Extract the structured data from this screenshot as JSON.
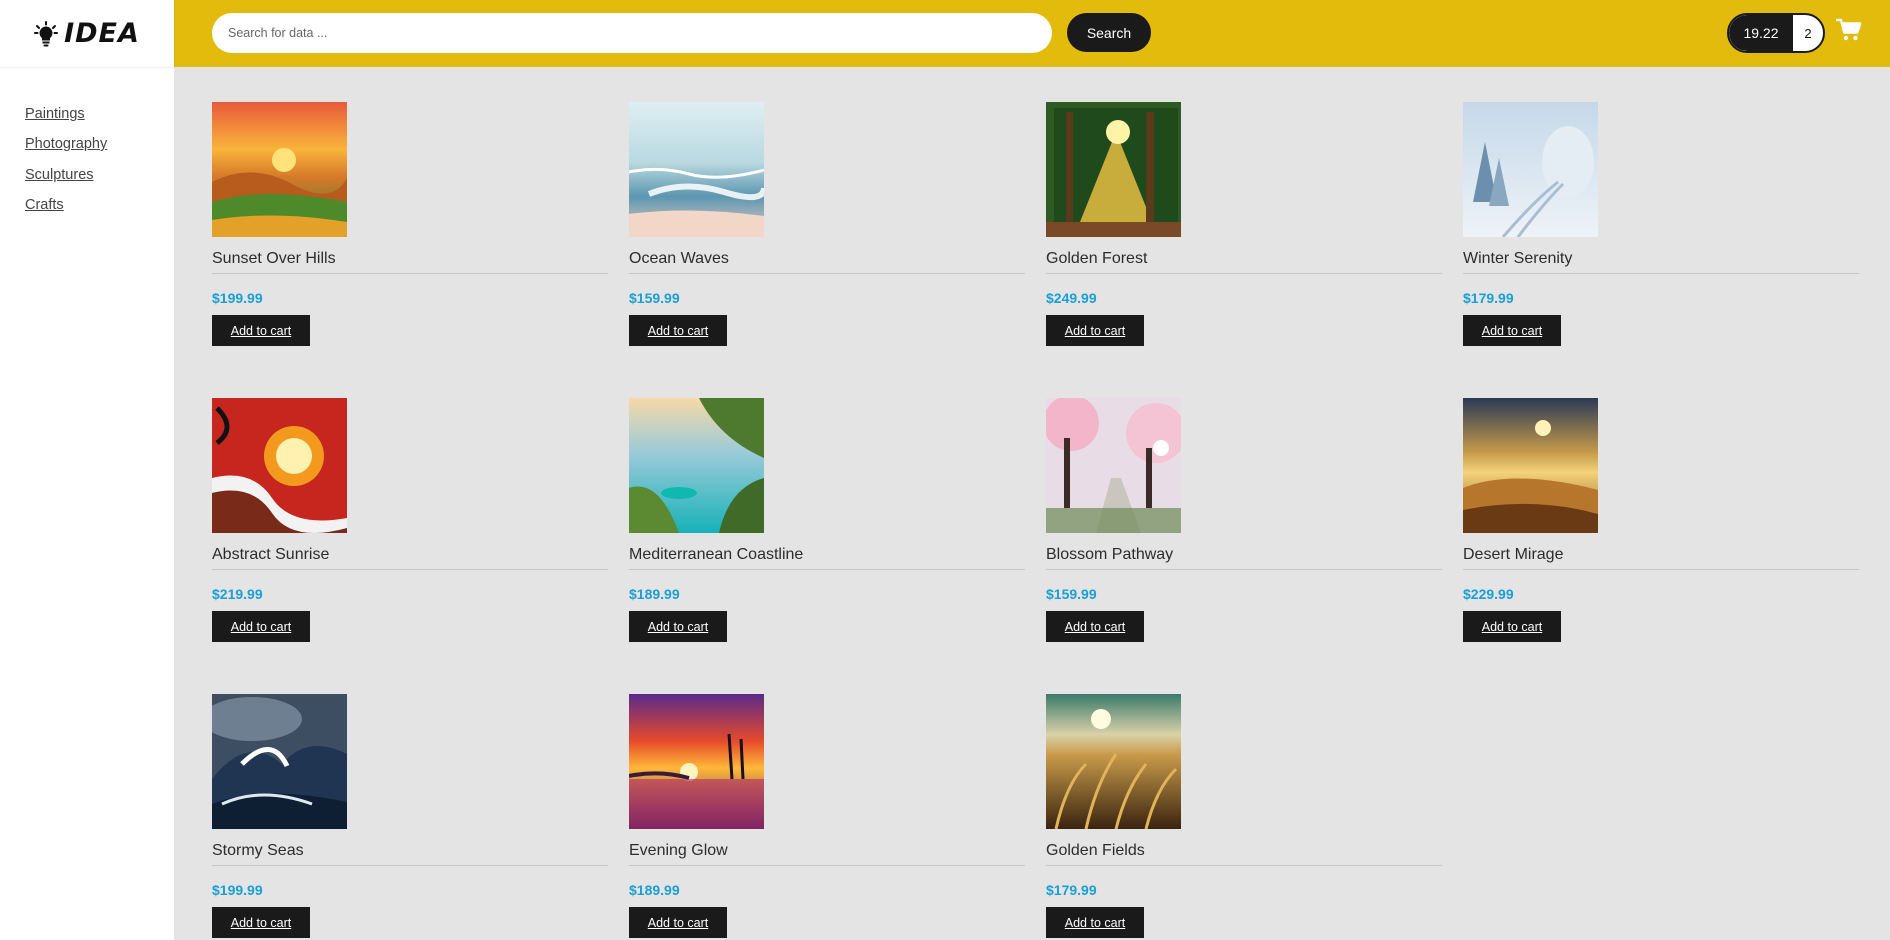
{
  "brand": {
    "name": "IDEA",
    "icon": "lightbulb-icon"
  },
  "sidebar": {
    "items": [
      {
        "label": "Paintings"
      },
      {
        "label": "Photography"
      },
      {
        "label": "Sculptures"
      },
      {
        "label": "Crafts"
      }
    ]
  },
  "header": {
    "search_placeholder": "Search for data ...",
    "search_button": "Search",
    "balance": "19.22",
    "cart_count": "2",
    "cart_icon": "shopping-cart-icon",
    "colors": {
      "header_bg": "#e2bb0c",
      "dark": "#1a1a1a",
      "price": "#1a9fd6"
    }
  },
  "products": [
    {
      "name": "Sunset Over Hills",
      "price": "$199.99",
      "button": "Add to cart"
    },
    {
      "name": "Ocean Waves",
      "price": "$159.99",
      "button": "Add to cart"
    },
    {
      "name": "Golden Forest",
      "price": "$249.99",
      "button": "Add to cart"
    },
    {
      "name": "Winter Serenity",
      "price": "$179.99",
      "button": "Add to cart"
    },
    {
      "name": "Abstract Sunrise",
      "price": "$219.99",
      "button": "Add to cart"
    },
    {
      "name": "Mediterranean Coastline",
      "price": "$189.99",
      "button": "Add to cart"
    },
    {
      "name": "Blossom Pathway",
      "price": "$159.99",
      "button": "Add to cart"
    },
    {
      "name": "Desert Mirage",
      "price": "$229.99",
      "button": "Add to cart"
    },
    {
      "name": "Stormy Seas",
      "price": "$199.99",
      "button": "Add to cart"
    },
    {
      "name": "Evening Glow",
      "price": "$189.99",
      "button": "Add to cart"
    },
    {
      "name": "Golden Fields",
      "price": "$179.99",
      "button": "Add to cart"
    }
  ]
}
